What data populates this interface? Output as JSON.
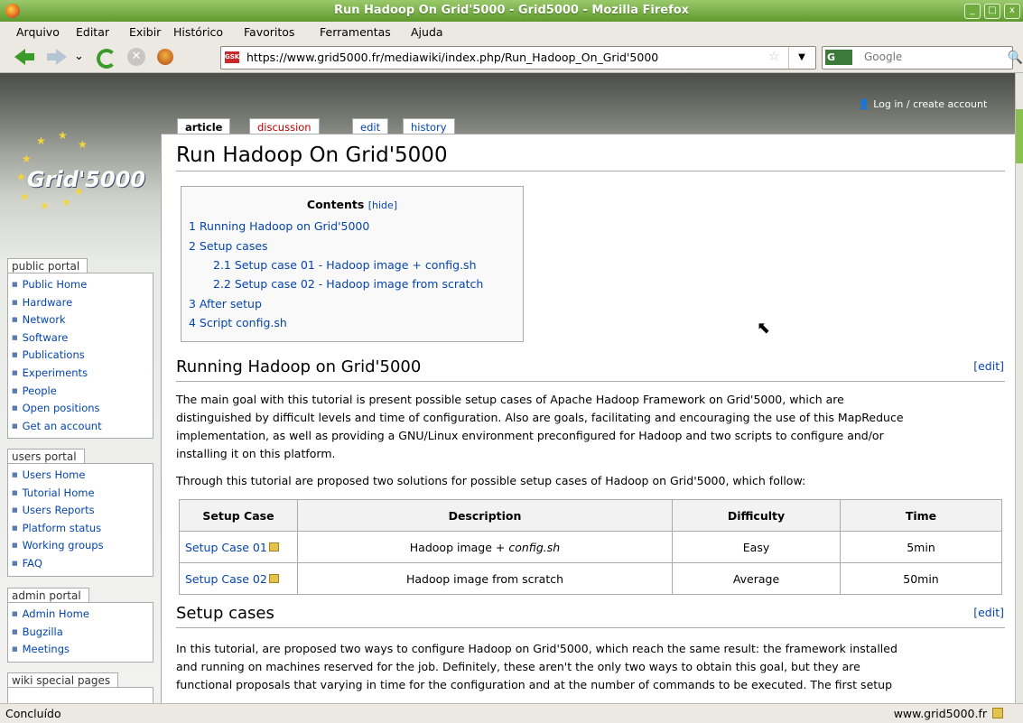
{
  "window": {
    "title": "Run Hadoop On Grid'5000 - Grid5000 - Mozilla Firefox"
  },
  "menu": [
    "Arquivo",
    "Editar",
    "Exibir",
    "Histórico",
    "Favoritos",
    "Ferramentas",
    "Ajuda"
  ],
  "toolbar": {
    "url": "https://www.grid5000.fr/mediawiki/index.php/Run_Hadoop_On_Grid'5000",
    "favicon": "GSK",
    "search_placeholder": "Google",
    "search_engine": "G"
  },
  "sidebar": {
    "logo_text": "Grid'5000",
    "public_portal": {
      "title": "public portal",
      "items": [
        "Public Home",
        "Hardware",
        "Network",
        "Software",
        "Publications",
        "Experiments",
        "People",
        "Open positions",
        "Get an account"
      ]
    },
    "users_portal": {
      "title": "users portal",
      "items": [
        "Users Home",
        "Tutorial Home",
        "Users Reports",
        "Platform status",
        "Working groups",
        "FAQ"
      ]
    },
    "admin_portal": {
      "title": "admin portal",
      "items": [
        "Admin Home",
        "Bugzilla",
        "Meetings"
      ]
    },
    "wiki_special": {
      "title": "wiki special pages"
    }
  },
  "page": {
    "login": "Log in / create account",
    "tabs": [
      "article",
      "discussion",
      "edit",
      "history"
    ],
    "title": "Run Hadoop On Grid'5000",
    "toc": {
      "title": "Contents",
      "hide": "[hide]",
      "items": [
        "1 Running Hadoop on Grid'5000",
        "2 Setup cases",
        "2.1 Setup case 01 - Hadoop image + config.sh",
        "2.2 Setup case 02 - Hadoop image from scratch",
        "3 After setup",
        "4 Script config.sh"
      ]
    },
    "edit_label": "[edit]",
    "section1": {
      "title": "Running Hadoop on Grid'5000",
      "p1": [
        "The main goal with this tutorial is present possible setup cases of Apache Hadoop Framework on Grid'5000, which are",
        "distinguished by difficult levels and time of configuration. Also are goals, facilitating and encouraging the use of this MapReduce",
        "implementation, as well as providing a GNU/Linux environment preconfigured for Hadoop and two scripts to configure and/or",
        "installing it on this platform."
      ],
      "p2": "Through this tutorial are proposed two solutions for possible setup cases of Hadoop on Grid'5000, which follow:"
    },
    "table": {
      "headers": [
        "Setup Case",
        "Description",
        "Difficulty",
        "Time"
      ],
      "rows": [
        {
          "case": "Setup Case 01",
          "desc_pre": "Hadoop image + ",
          "desc_em": "config.sh",
          "difficulty": "Easy",
          "time": "5min"
        },
        {
          "case": "Setup Case 02",
          "desc_pre": "Hadoop image from scratch",
          "desc_em": "",
          "difficulty": "Average",
          "time": "50min"
        }
      ]
    },
    "section2": {
      "title": "Setup cases",
      "p1": [
        "In this tutorial, are proposed two ways to configure Hadoop on Grid'5000, which reach the same result: the framework installed",
        "and running on machines reserved for the job. Definitely, these aren't the only two ways to obtain this goal, but they are",
        "functional proposals that varying in time for the configuration and at the number of commands to be executed. The first setup"
      ]
    }
  },
  "status": {
    "text": "Concluído",
    "host": "www.grid5000.fr"
  }
}
